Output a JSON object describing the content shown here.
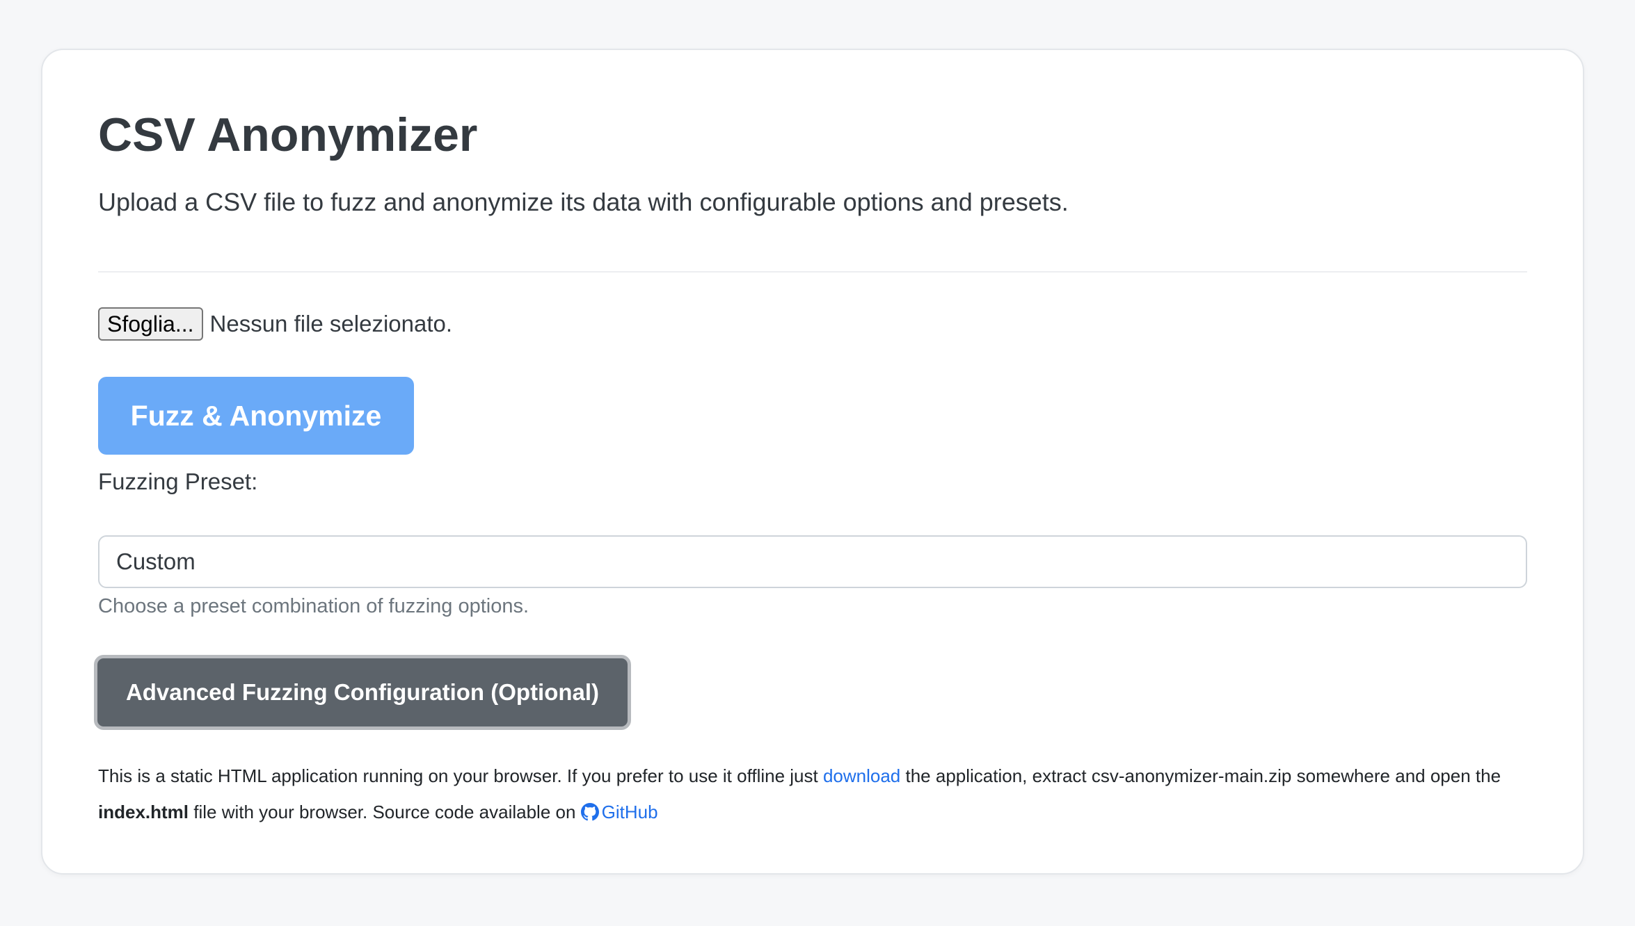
{
  "header": {
    "title": "CSV Anonymizer",
    "description": "Upload a CSV file to fuzz and anonymize its data with configurable options and presets."
  },
  "file_input": {
    "browse_label": "Sfoglia...",
    "status": "Nessun file selezionato."
  },
  "actions": {
    "fuzz_label": "Fuzz & Anonymize",
    "advanced_label": "Advanced Fuzzing Configuration (Optional)"
  },
  "preset": {
    "label": "Fuzzing Preset:",
    "selected": "Custom",
    "help": "Choose a preset combination of fuzzing options."
  },
  "footer": {
    "text_1": "This is a static HTML application running on your browser. If you prefer to use it offline just ",
    "download_link": "download",
    "text_2": " the application, extract csv-anonymizer-main.zip somewhere and open the ",
    "index_file": "index.html",
    "text_3": " file with your browser. Source code available on ",
    "github_link": "GitHub"
  },
  "colors": {
    "page_background": "#f6f7f9",
    "primary_button": "#6aaaf8",
    "secondary_button": "#5c636a",
    "link": "#1f6feb",
    "muted_text": "#6c757d"
  },
  "icons": {
    "github": "github-icon"
  }
}
